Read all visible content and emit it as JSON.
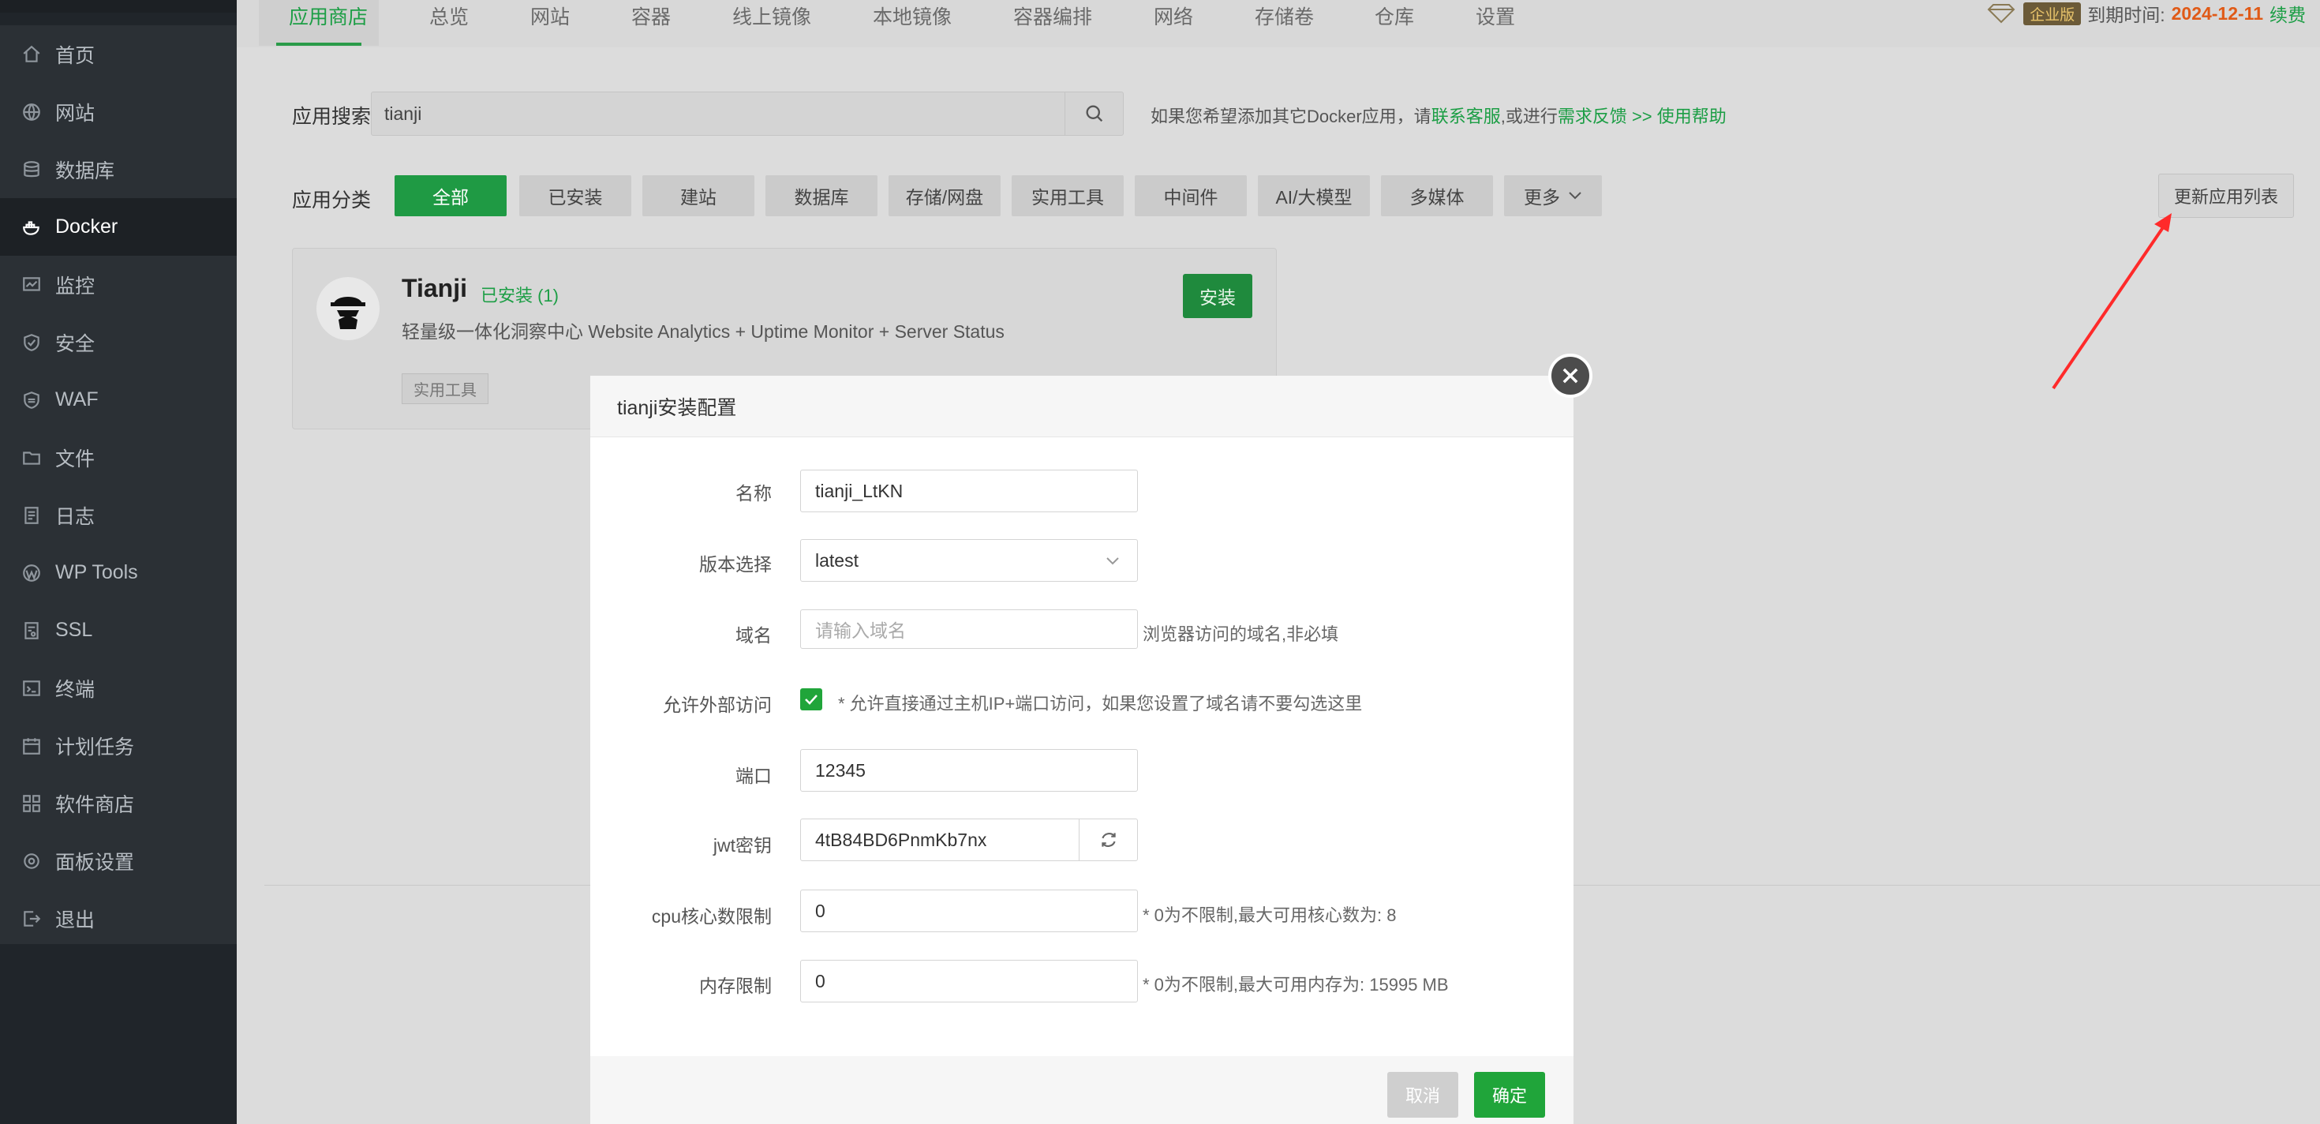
{
  "sidebar": {
    "items": [
      {
        "label": "首页",
        "icon": "home-icon"
      },
      {
        "label": "网站",
        "icon": "globe-icon"
      },
      {
        "label": "数据库",
        "icon": "database-icon"
      },
      {
        "label": "Docker",
        "icon": "docker-icon",
        "active": true
      },
      {
        "label": "监控",
        "icon": "monitor-icon"
      },
      {
        "label": "安全",
        "icon": "shield-icon"
      },
      {
        "label": "WAF",
        "icon": "waf-shield-icon"
      },
      {
        "label": "文件",
        "icon": "folder-icon"
      },
      {
        "label": "日志",
        "icon": "log-icon"
      },
      {
        "label": "WP Tools",
        "icon": "wordpress-icon"
      },
      {
        "label": "SSL",
        "icon": "ssl-icon"
      },
      {
        "label": "终端",
        "icon": "terminal-icon"
      },
      {
        "label": "计划任务",
        "icon": "calendar-icon"
      },
      {
        "label": "软件商店",
        "icon": "grid-icon"
      },
      {
        "label": "面板设置",
        "icon": "gear-icon"
      },
      {
        "label": "退出",
        "icon": "logout-icon"
      }
    ]
  },
  "tabs": [
    "应用商店",
    "总览",
    "网站",
    "容器",
    "线上镜像",
    "本地镜像",
    "容器编排",
    "网络",
    "存储卷",
    "仓库",
    "设置"
  ],
  "license": {
    "badge": "企业版",
    "expire_label": "到期时间:",
    "expire_date": "2024-12-11",
    "renew": "续费"
  },
  "search": {
    "label": "应用搜索",
    "value": "tianji"
  },
  "hint": {
    "prefix": "如果您希望添加其它Docker应用，请",
    "contact": "联系客服",
    "mid": ",或进行",
    "feedback": "需求反馈",
    "arrows": " >> ",
    "help": "使用帮助"
  },
  "category": {
    "label": "应用分类",
    "items": [
      "全部",
      "已安装",
      "建站",
      "数据库",
      "存储/网盘",
      "实用工具",
      "中间件",
      "AI/大模型",
      "多媒体",
      "更多"
    ],
    "refresh": "更新应用列表"
  },
  "app_card": {
    "name": "Tianji",
    "installed": "已安装 (1)",
    "description": "轻量级一体化洞察中心 Website Analytics + Uptime Monitor + Server Status",
    "tag": "实用工具",
    "install_button": "安装"
  },
  "modal": {
    "title": "tianji安装配置",
    "fields": {
      "name": {
        "label": "名称",
        "value": "tianji_LtKN"
      },
      "version": {
        "label": "版本选择",
        "value": "latest"
      },
      "domain": {
        "label": "域名",
        "placeholder": "请输入域名",
        "note": "浏览器访问的域名,非必填"
      },
      "external": {
        "label": "允许外部访问",
        "note": "* 允许直接通过主机IP+端口访问，如果您设置了域名请不要勾选这里"
      },
      "port": {
        "label": "端口",
        "value": "12345"
      },
      "jwt": {
        "label": "jwt密钥",
        "value": "4tB84BD6PnmKb7nx"
      },
      "cpu": {
        "label": "cpu核心数限制",
        "value": "0",
        "note": "* 0为不限制,最大可用核心数为: 8"
      },
      "memory": {
        "label": "内存限制",
        "value": "0",
        "note": "* 0为不限制,最大可用内存为: 15995 MB"
      }
    },
    "cancel": "取消",
    "confirm": "确定"
  },
  "colors": {
    "accent": "#20a53a",
    "sidebar_bg": "#2b3035",
    "expire_date": "#e05a17",
    "arrow": "#ff2a2a"
  }
}
